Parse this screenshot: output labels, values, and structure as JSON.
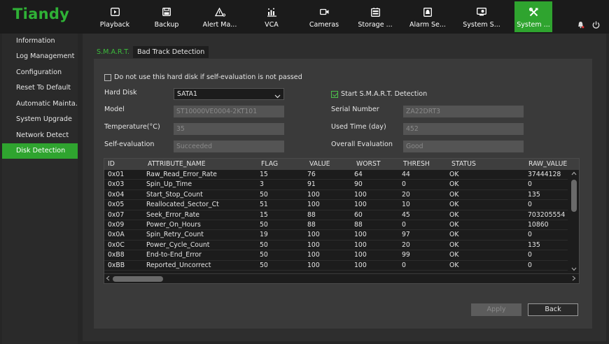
{
  "app": {
    "logo": "Tiandy"
  },
  "nav": [
    {
      "label": "Playback",
      "icon": "playback-icon"
    },
    {
      "label": "Backup",
      "icon": "save-icon"
    },
    {
      "label": "Alert Ma...",
      "icon": "alert-icon"
    },
    {
      "label": "VCA",
      "icon": "vca-icon"
    },
    {
      "label": "Cameras",
      "icon": "camera-icon"
    },
    {
      "label": "Storage ...",
      "icon": "storage-icon"
    },
    {
      "label": "Alarm Se...",
      "icon": "alarm-icon"
    },
    {
      "label": "System S...",
      "icon": "monitor-icon"
    },
    {
      "label": "System ...",
      "icon": "tools-icon"
    }
  ],
  "sidebar": [
    {
      "label": "Information"
    },
    {
      "label": "Log Management"
    },
    {
      "label": "Configuration"
    },
    {
      "label": "Reset To Default"
    },
    {
      "label": "Automatic Mainta..."
    },
    {
      "label": "System Upgrade"
    },
    {
      "label": "Network Detect"
    },
    {
      "label": "Disk Detection"
    }
  ],
  "tabs": {
    "smart": "S.M.A.R.T.",
    "bad_track": "Bad Track Detection"
  },
  "form": {
    "no_use_label": "Do not use this hard disk if self-evaluation is not passed",
    "hard_disk_label": "Hard Disk",
    "hard_disk_value": "SATA1",
    "start_smart_label": "Start S.M.A.R.T. Detection",
    "model_label": "Model",
    "model_value": "ST10000VE0004-2KT101",
    "serial_label": "Serial Number",
    "serial_value": "ZA22DRT3",
    "temp_label": "Temperature(°C)",
    "temp_value": "35",
    "used_time_label": "Used Time (day)",
    "used_time_value": "452",
    "self_eval_label": "Self-evaluation",
    "self_eval_value": "Succeeded",
    "overall_label": "Overall Evaluation",
    "overall_value": "Good"
  },
  "table": {
    "headers": [
      "ID",
      "ATTRIBUTE_NAME",
      "FLAG",
      "VALUE",
      "WORST",
      "THRESH",
      "STATUS",
      "RAW_VALUE"
    ],
    "rows": [
      [
        "0x01",
        "Raw_Read_Error_Rate",
        "15",
        "76",
        "64",
        "44",
        "OK",
        "37444128"
      ],
      [
        "0x03",
        "Spin_Up_Time",
        "3",
        "91",
        "90",
        "0",
        "OK",
        "0"
      ],
      [
        "0x04",
        "Start_Stop_Count",
        "50",
        "100",
        "100",
        "20",
        "OK",
        "135"
      ],
      [
        "0x05",
        "Reallocated_Sector_Ct",
        "51",
        "100",
        "100",
        "10",
        "OK",
        "0"
      ],
      [
        "0x07",
        "Seek_Error_Rate",
        "15",
        "88",
        "60",
        "45",
        "OK",
        "703205554"
      ],
      [
        "0x09",
        "Power_On_Hours",
        "50",
        "88",
        "88",
        "0",
        "OK",
        "10860"
      ],
      [
        "0x0A",
        "Spin_Retry_Count",
        "19",
        "100",
        "100",
        "97",
        "OK",
        "0"
      ],
      [
        "0x0C",
        "Power_Cycle_Count",
        "50",
        "100",
        "100",
        "20",
        "OK",
        "135"
      ],
      [
        "0xB8",
        "End-to-End_Error",
        "50",
        "100",
        "100",
        "99",
        "OK",
        "0"
      ],
      [
        "0xBB",
        "Reported_Uncorrect",
        "50",
        "100",
        "100",
        "0",
        "OK",
        "0"
      ]
    ]
  },
  "buttons": {
    "apply": "Apply",
    "back": "Back"
  },
  "colors": {
    "accent": "#2fa42f",
    "logo": "#2fb136"
  }
}
